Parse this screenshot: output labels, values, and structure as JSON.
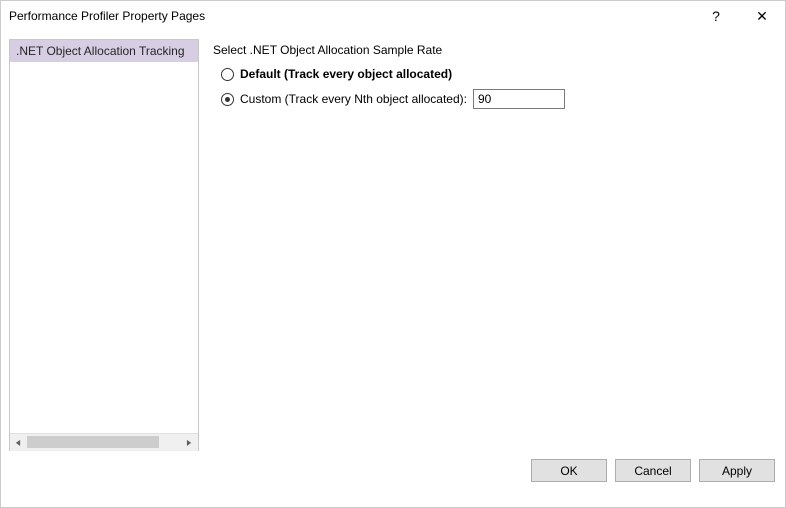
{
  "window": {
    "title": "Performance Profiler Property Pages"
  },
  "sidebar": {
    "items": [
      {
        "label": ".NET Object Allocation Tracking",
        "selected": true
      }
    ]
  },
  "content": {
    "section_label": "Select .NET Object Allocation Sample Rate",
    "options": {
      "default_label": "Default (Track every object allocated)",
      "custom_label": "Custom (Track every Nth object allocated):",
      "custom_value": "90",
      "selected": "custom"
    }
  },
  "footer": {
    "ok": "OK",
    "cancel": "Cancel",
    "apply": "Apply"
  },
  "icons": {
    "help": "?",
    "close": "✕",
    "left": "◀",
    "right": "▶"
  }
}
